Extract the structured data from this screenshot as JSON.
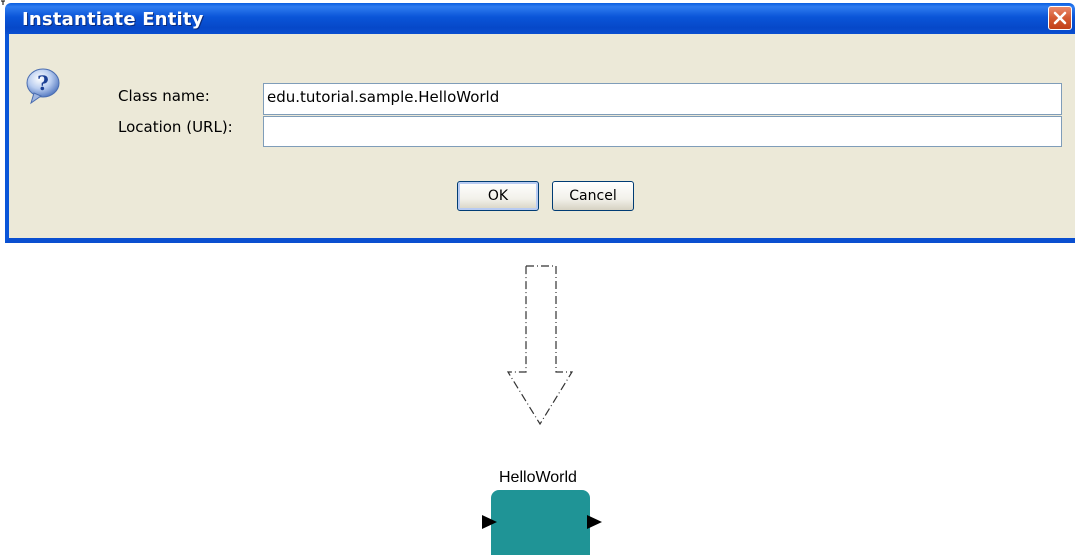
{
  "dialog": {
    "title": "Instantiate Entity",
    "icon": "question-icon",
    "fields": [
      {
        "label": "Class name:",
        "value": "edu.tutorial.sample.HelloWorld",
        "placeholder": ""
      },
      {
        "label": "Location (URL):",
        "value": "",
        "placeholder": ""
      }
    ],
    "buttons": {
      "ok": "OK",
      "cancel": "Cancel"
    }
  },
  "diagram": {
    "arrow_icon": "down-arrow-icon",
    "actor": {
      "name": "HelloWorld",
      "color": "#1f9496"
    }
  },
  "colors": {
    "titlebar": "#0a55d8",
    "dialog_bg": "#ece9d8",
    "close": "#d45a32"
  }
}
